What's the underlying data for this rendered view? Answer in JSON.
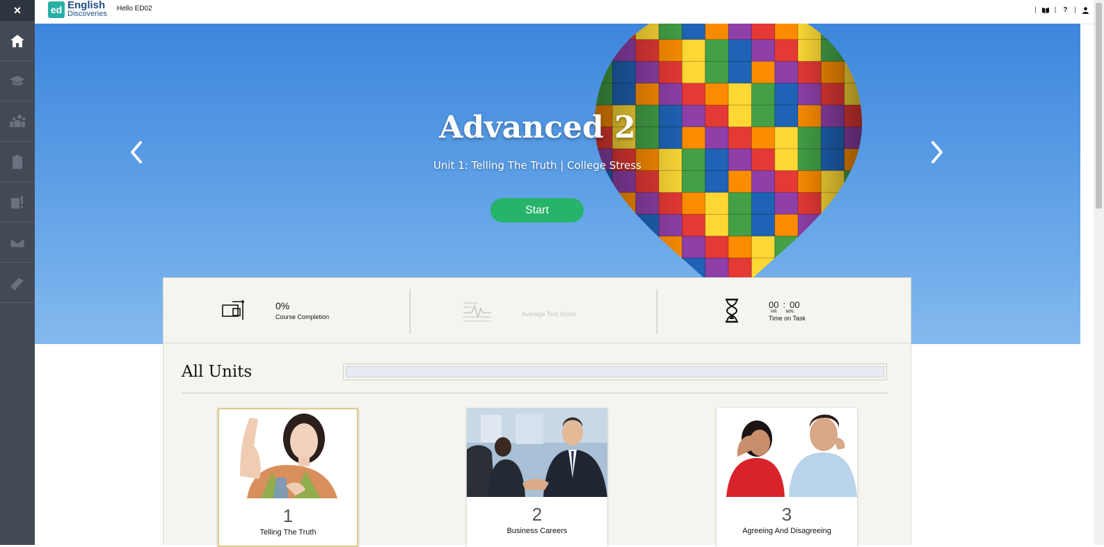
{
  "app": {
    "brand_badge": "ed",
    "brand_line1": "English",
    "brand_line2": "Discoveries",
    "greeting": "Hello ED02"
  },
  "header_tools": {
    "sep": "|",
    "help": "?"
  },
  "sidebar": {
    "close": "×",
    "items": [
      {
        "icon": "home-icon",
        "active": true
      },
      {
        "icon": "graduation-cap-icon"
      },
      {
        "icon": "community-icon"
      },
      {
        "icon": "clipboard-icon"
      },
      {
        "icon": "assessments-icon"
      },
      {
        "icon": "mail-icon"
      },
      {
        "icon": "book-icon"
      }
    ]
  },
  "hero": {
    "title": "Advanced 2",
    "subtitle": "Unit 1: Telling The Truth  |  College Stress",
    "start_label": "Start"
  },
  "stats": {
    "completion_value": "0%",
    "completion_label": "Course Completion",
    "avg_score_label": "Average Test Score",
    "time_hr": "00",
    "time_colon": ":",
    "time_min": "00",
    "time_hr_unit": "HR",
    "time_min_unit": "MIN",
    "time_label": "Time on Task"
  },
  "units": {
    "title": "All Units",
    "progress": 0,
    "cards": [
      {
        "number": "1",
        "name": "Telling The Truth",
        "current": true
      },
      {
        "number": "2",
        "name": "Business Careers"
      },
      {
        "number": "3",
        "name": "Agreeing And Disagreeing"
      }
    ]
  },
  "colors": {
    "sidebar": "#434a56",
    "hero_top": "#3d86dc",
    "start_button": "#26b36a",
    "panel_bg": "#f5f5ef"
  }
}
